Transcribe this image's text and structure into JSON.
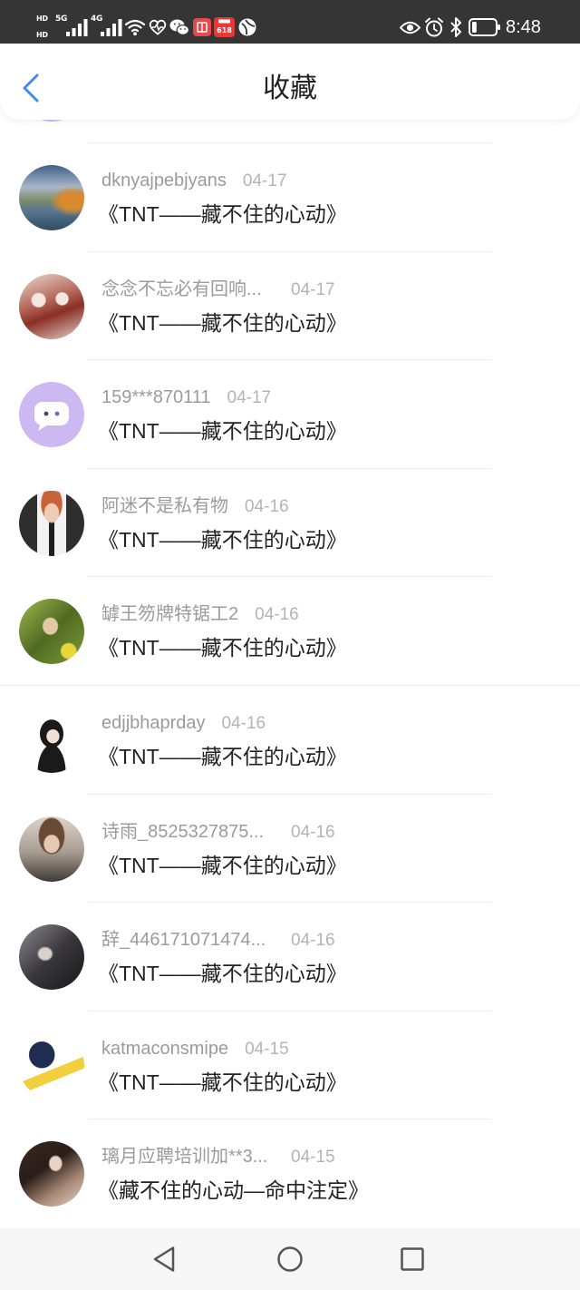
{
  "status_bar": {
    "sim1": {
      "hd": "HD",
      "network": "5G",
      "icon": "signal-bars-icon"
    },
    "sim2": {
      "hd": "HD",
      "network": "4G",
      "icon": "signal-bars-icon"
    },
    "left_icons": [
      "wifi-icon",
      "heart-pulse-icon",
      "wechat-icon",
      "red-app-icon",
      "shopping-618-icon",
      "circle-app-icon"
    ],
    "badge_618": "618",
    "right_icons": [
      "eye-icon",
      "alarm-icon",
      "bluetooth-icon",
      "battery-icon"
    ],
    "battery_level": 0.2,
    "time": "8:48"
  },
  "header": {
    "back_icon": "chevron-left-icon",
    "title": "收藏"
  },
  "colors": {
    "accent": "#3c8ee8",
    "status_bar_bg": "#353535",
    "name_text": "#9b9b9b",
    "date_text": "#b4b4b4",
    "title_text": "#222222",
    "nav_bar_bg": "#f6f6f6"
  },
  "partial_item": {
    "avatar": "chat-bubble-default"
  },
  "items": [
    {
      "name": "dknyajpebjyans",
      "date": "04-17",
      "title": "《TNT——藏不住的心动》",
      "avatar": "landscape-photo"
    },
    {
      "name": "念念不忘必有回响...",
      "date": "04-17",
      "title": "《TNT——藏不住的心动》",
      "avatar": "group-photo"
    },
    {
      "name": "159***870111",
      "date": "04-17",
      "title": "《TNT——藏不住的心动》",
      "avatar": "chat-bubble-default"
    },
    {
      "name": "阿迷不是私有物",
      "date": "04-16",
      "title": "《TNT——藏不住的心动》",
      "avatar": "person-photo"
    },
    {
      "name": "罅王笏牌特锯工2",
      "date": "04-16",
      "title": "《TNT——藏不住的心动》",
      "avatar": "nature-photo"
    },
    {
      "name": "edjjbhaprday",
      "date": "04-16",
      "title": "《TNT——藏不住的心动》",
      "avatar": "illustrated-girl"
    },
    {
      "name": "诗雨_8525327875...",
      "date": "04-16",
      "title": "《TNT——藏不住的心动》",
      "avatar": "portrait-photo"
    },
    {
      "name": "辞_446171071474...",
      "date": "04-16",
      "title": "《TNT——藏不住的心动》",
      "avatar": "dark-photo"
    },
    {
      "name": "katmaconsmipe",
      "date": "04-15",
      "title": "《TNT——藏不住的心动》",
      "avatar": "figure-banner"
    },
    {
      "name": "璃月应聘培训加**3...",
      "date": "04-15",
      "title": "《藏不住的心动—命中注定》",
      "avatar": "sepia-photo"
    }
  ],
  "nav_bar": {
    "back_icon": "triangle-back-icon",
    "home_icon": "circle-home-icon",
    "recents_icon": "square-recents-icon"
  }
}
